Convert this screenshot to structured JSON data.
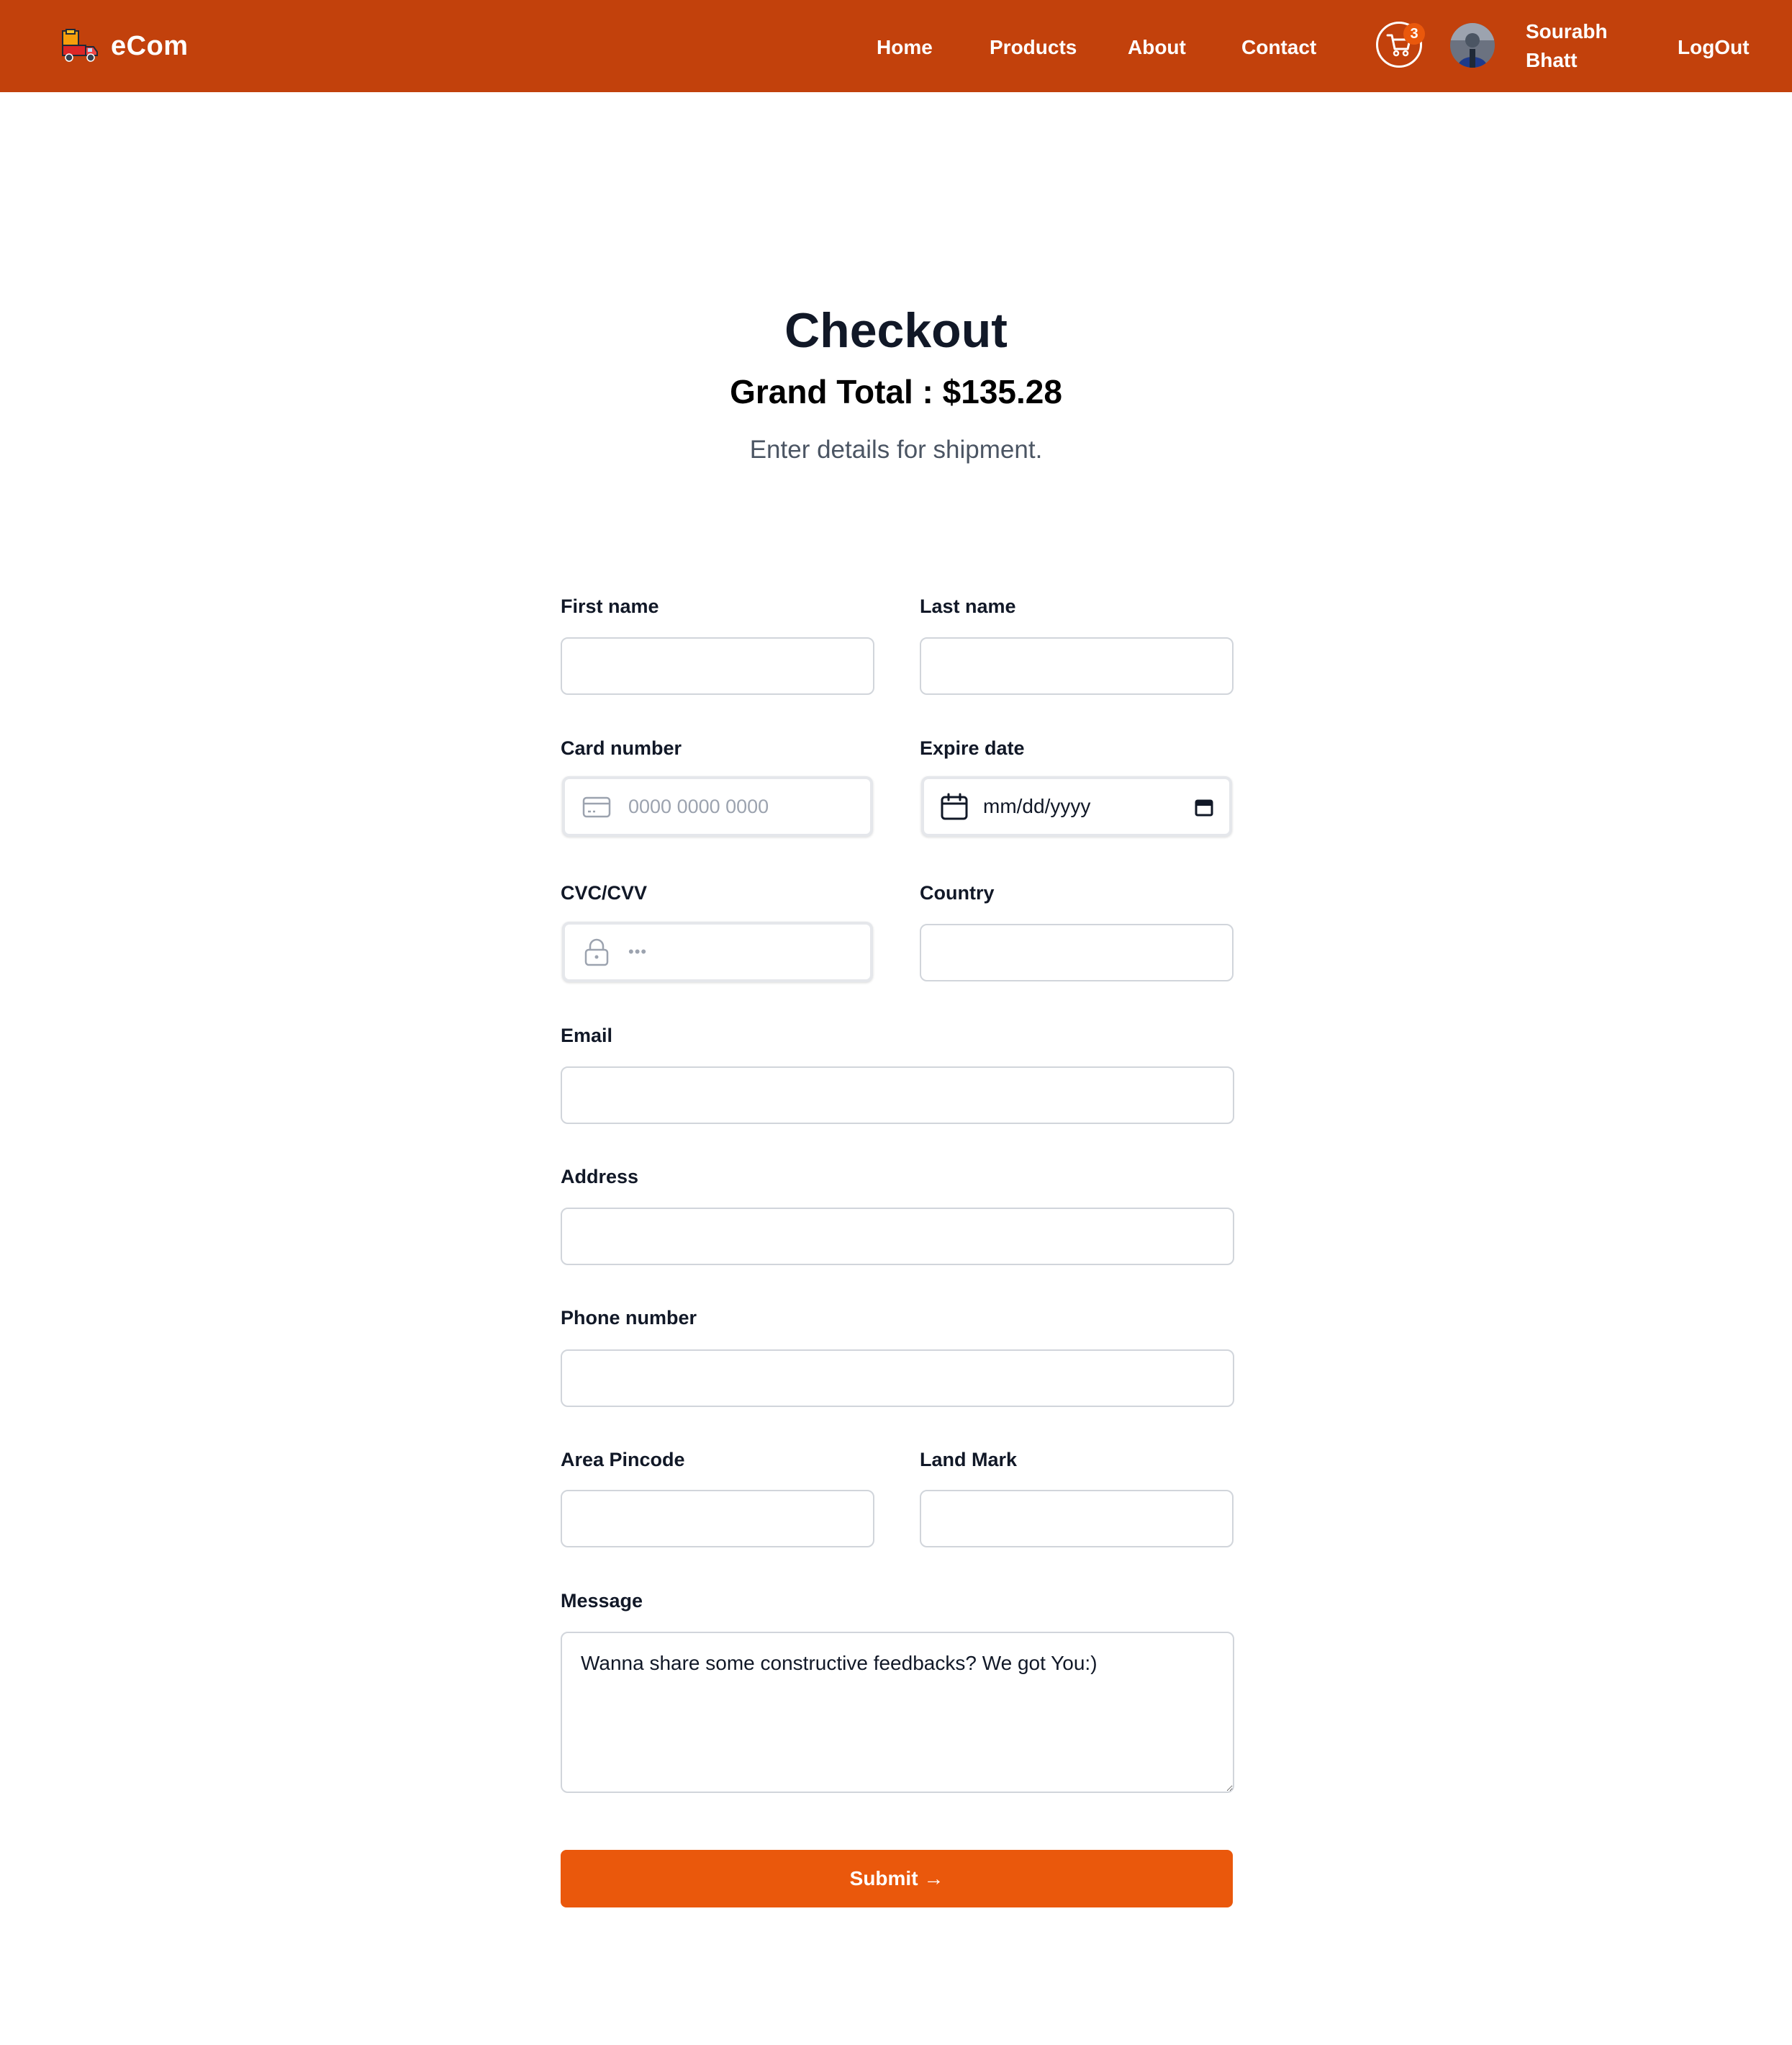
{
  "brand": {
    "name": "eCom"
  },
  "nav": {
    "links": [
      {
        "label": "Home"
      },
      {
        "label": "Products"
      },
      {
        "label": "About"
      },
      {
        "label": "Contact"
      }
    ],
    "cart_count": "3",
    "user": {
      "first": "Sourabh",
      "last": "Bhatt"
    },
    "logout": "LogOut"
  },
  "header": {
    "title": "Checkout",
    "grand_total": "Grand Total : $135.28",
    "subtitle": "Enter details for shipment."
  },
  "form": {
    "first_name": {
      "label": "First name",
      "value": ""
    },
    "last_name": {
      "label": "Last name",
      "value": ""
    },
    "card_number": {
      "label": "Card number",
      "placeholder": "0000 0000 0000"
    },
    "expire_date": {
      "label": "Expire date",
      "value": "mm/dd/yyyy"
    },
    "cvc": {
      "label": "CVC/CVV",
      "placeholder": "•••"
    },
    "country": {
      "label": "Country",
      "value": ""
    },
    "email": {
      "label": "Email",
      "value": ""
    },
    "address": {
      "label": "Address",
      "value": ""
    },
    "phone": {
      "label": "Phone number",
      "value": ""
    },
    "pincode": {
      "label": "Area Pincode",
      "value": ""
    },
    "landmark": {
      "label": "Land Mark",
      "value": ""
    },
    "message": {
      "label": "Message",
      "value": "Wanna share some constructive feedbacks? We got You:)"
    },
    "submit": "Submit →"
  },
  "colors": {
    "navbar": "#c2410c",
    "accent": "#ea580c",
    "heading": "#111827",
    "muted": "#4b5563"
  },
  "icons": [
    "delivery-truck-logo",
    "cart-icon",
    "credit-card-icon",
    "calendar-icon",
    "lock-icon"
  ]
}
